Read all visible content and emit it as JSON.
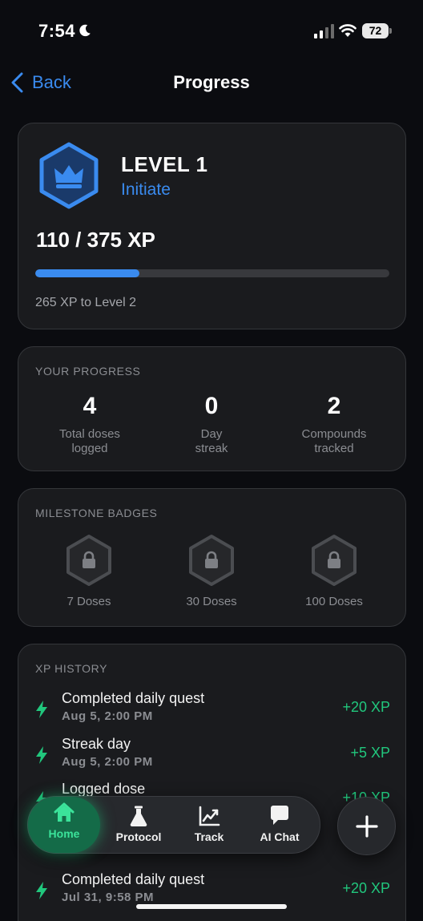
{
  "status_bar": {
    "time": "7:54",
    "battery": "72",
    "icons": [
      "moon-icon",
      "signal-icon",
      "wifi-icon",
      "battery-icon"
    ]
  },
  "nav": {
    "back_label": "Back",
    "title": "Progress"
  },
  "level_card": {
    "level_label": "LEVEL 1",
    "rank": "Initiate",
    "xp_text": "110 / 375 XP",
    "xp_progress": 0.2933,
    "xp_remaining": "265 XP to Level 2",
    "icon": "crown-icon"
  },
  "progress_card": {
    "heading": "YOUR PROGRESS",
    "stats": [
      {
        "value": "4",
        "label": "Total doses\nlogged"
      },
      {
        "value": "0",
        "label": "Day\nstreak"
      },
      {
        "value": "2",
        "label": "Compounds\ntracked"
      }
    ]
  },
  "badges_card": {
    "heading": "MILESTONE BADGES",
    "badges": [
      {
        "label": "7 Doses",
        "icon": "lock-icon"
      },
      {
        "label": "30 Doses",
        "icon": "lock-icon"
      },
      {
        "label": "100 Doses",
        "icon": "lock-icon"
      }
    ]
  },
  "history_card": {
    "heading": "XP HISTORY",
    "entries": [
      {
        "title": "Completed daily quest",
        "time": "Aug 5, 2:00 PM",
        "xp": "+20 XP"
      },
      {
        "title": "Streak day",
        "time": "Aug 5, 2:00 PM",
        "xp": "+5 XP"
      },
      {
        "title": "Logged dose",
        "time": "",
        "xp": "+10 XP"
      },
      {
        "title": "Completed daily quest",
        "time": "Jul 31, 9:58 PM",
        "xp": "+20 XP"
      }
    ]
  },
  "tabbar": {
    "tabs": [
      {
        "label": "Home",
        "icon": "home-icon",
        "active": true
      },
      {
        "label": "Protocol",
        "icon": "flask-icon"
      },
      {
        "label": "Track",
        "icon": "chart-icon"
      },
      {
        "label": "AI Chat",
        "icon": "chat-icon"
      }
    ],
    "fab_icon": "plus-icon"
  },
  "colors": {
    "accent_blue": "#3a8bef",
    "accent_green": "#21c77d",
    "card_bg": "#1a1b1e",
    "page_bg": "#0b0c10"
  }
}
